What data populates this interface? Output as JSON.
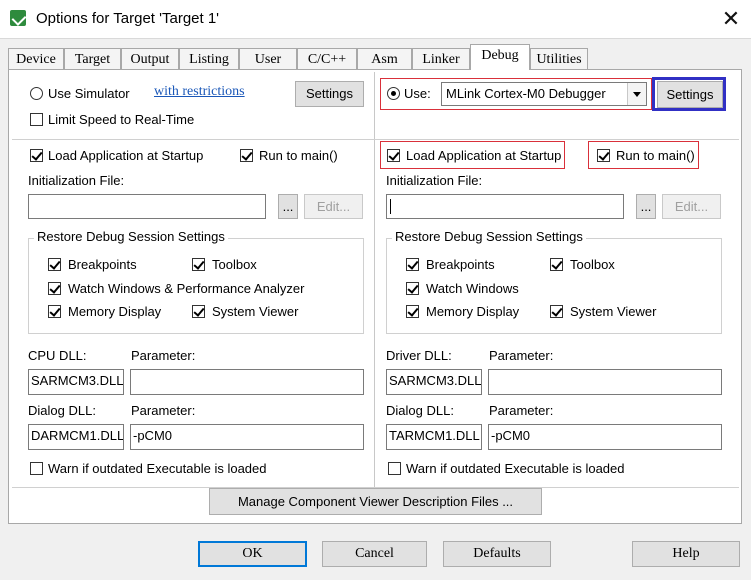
{
  "window": {
    "title": "Options for Target 'Target 1'",
    "close": "✕"
  },
  "tabs": [
    "Device",
    "Target",
    "Output",
    "Listing",
    "User",
    "C/C++",
    "Asm",
    "Linker",
    "Debug",
    "Utilities"
  ],
  "left": {
    "use_simulator": "Use Simulator",
    "with_restrictions": "with restrictions",
    "settings": "Settings",
    "limit_speed": "Limit Speed to Real-Time",
    "load_app": "Load Application at Startup",
    "run_to_main": "Run to main()",
    "init_file_label": "Initialization File:",
    "browse": "...",
    "edit": "Edit...",
    "restore_group": "Restore Debug Session Settings",
    "breakpoints": "Breakpoints",
    "toolbox": "Toolbox",
    "watch_windows": "Watch Windows & Performance Analyzer",
    "memory_display": "Memory Display",
    "system_viewer": "System Viewer",
    "cpu_dll_label": "CPU DLL:",
    "cpu_dll_value": "SARMCM3.DLL",
    "parameter_label": "Parameter:",
    "cpu_param_value": "",
    "dialog_dll_label": "Dialog DLL:",
    "dialog_dll_value": "DARMCM1.DLL",
    "dialog_param_value": "-pCM0",
    "warn_outdated": "Warn if outdated Executable is loaded"
  },
  "right": {
    "use": "Use:",
    "debugger": "MLink Cortex-M0 Debugger",
    "settings": "Settings",
    "load_app": "Load Application at Startup",
    "run_to_main": "Run to main()",
    "init_file_label": "Initialization File:",
    "browse": "...",
    "edit": "Edit...",
    "restore_group": "Restore Debug Session Settings",
    "breakpoints": "Breakpoints",
    "toolbox": "Toolbox",
    "watch_windows": "Watch Windows",
    "memory_display": "Memory Display",
    "system_viewer": "System Viewer",
    "driver_dll_label": "Driver DLL:",
    "driver_dll_value": "SARMCM3.DLL",
    "parameter_label": "Parameter:",
    "driver_param_value": "",
    "dialog_dll_label": "Dialog DLL:",
    "dialog_dll_value": "TARMCM1.DLL",
    "dialog_param_value": "-pCM0",
    "warn_outdated": "Warn if outdated Executable is loaded"
  },
  "manage_button": "Manage Component Viewer Description Files ...",
  "buttons": {
    "ok": "OK",
    "cancel": "Cancel",
    "defaults": "Defaults",
    "help": "Help"
  },
  "colors": {
    "highlight_red": "#d9303a",
    "highlight_blue": "#3130c4"
  }
}
